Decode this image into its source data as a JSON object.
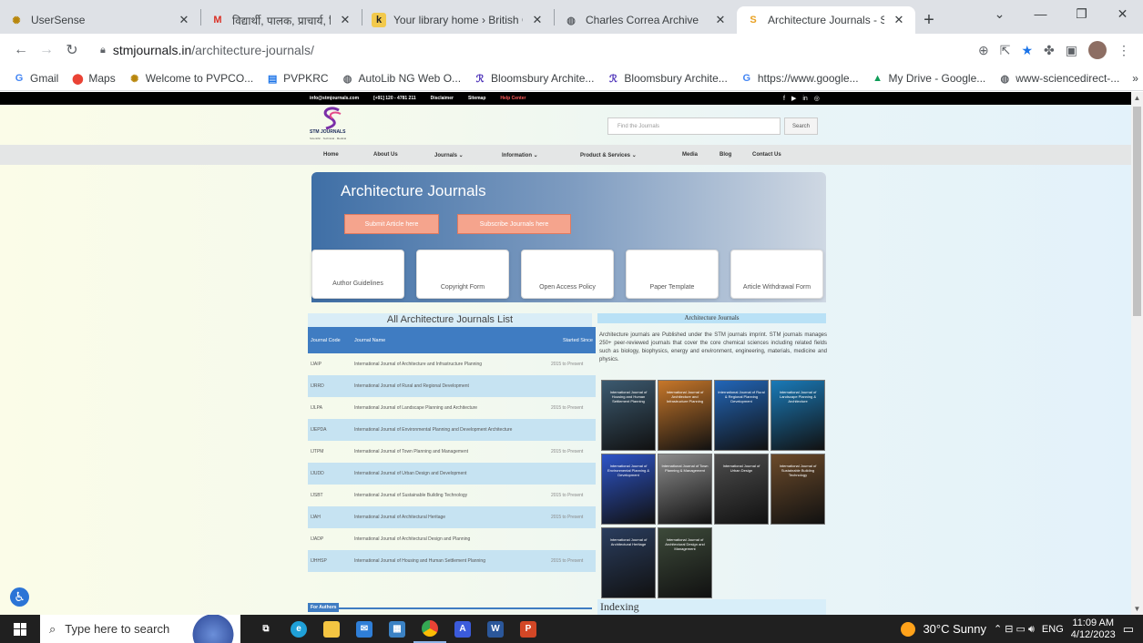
{
  "browser": {
    "tabs": [
      {
        "title": "UserSense",
        "icon": "usersense-icon"
      },
      {
        "title": "विद्यार्थी, पालक, प्राचार्य, शिक्षक,सं",
        "icon": "gmail-icon"
      },
      {
        "title": "Your library home › British Co",
        "icon": "library-icon"
      },
      {
        "title": "Charles Correa Archive",
        "icon": "globe-icon"
      },
      {
        "title": "Architecture Journals - STM J",
        "icon": "stm-icon"
      }
    ],
    "url_host": "stmjournals.in",
    "url_path": "/architecture-journals/",
    "bookmarks": [
      "Gmail",
      "Maps",
      "Welcome to PVPCO...",
      "PVPKRC",
      "AutoLib NG Web O...",
      "Bloomsbury Archite...",
      "Bloomsbury Archite...",
      "https://www.google...",
      "My Drive - Google...",
      "www-sciencedirect-..."
    ],
    "bookmarks_more": "»"
  },
  "site": {
    "topbar": {
      "email": "info@stmjournals.com",
      "phone": "[+91] 120 - 4781 211",
      "disclaimer": "Disclaimer",
      "sitemap": "Sitemap",
      "help": "Help Center"
    },
    "logo": {
      "text": "STM JOURNALS",
      "sub": "Scientific · Technical · Medical"
    },
    "search": {
      "placeholder": "Find the Journals",
      "button": "Search"
    },
    "nav": [
      "Home",
      "About Us",
      "Journals ⌄",
      "Information ⌄",
      "Product & Services ⌄",
      "Media",
      "Blog",
      "Contact Us"
    ],
    "hero": {
      "title": "Architecture Journals",
      "submit": "Submit Article here",
      "subscribe": "Subscribe Journals here"
    },
    "quick_links": [
      "Author Guidelines",
      "Copyright Form",
      "Open Access Policy",
      "Paper Template",
      "Article Withdrawal Form"
    ],
    "list_title": "All Architecture Journals List",
    "table_headers": {
      "code": "Journal Code",
      "name": "Journal Name",
      "since": "Started Since"
    },
    "journals": [
      {
        "code": "IJAIP",
        "name": "International Journal of Architecture and Infrastructure Planning",
        "since": "2015 to Present"
      },
      {
        "code": "IJRRD",
        "name": "International Journal of Rural and Regional Development",
        "since": ""
      },
      {
        "code": "IJLPA",
        "name": "International Journal of Landscape Planning and Architecture",
        "since": "2015 to Present"
      },
      {
        "code": "IJEPDA",
        "name": "International Journal of Environmental Planning and Development Architecture",
        "since": ""
      },
      {
        "code": "IJTPM",
        "name": "International Journal of Town Planning and Management",
        "since": "2015 to Present"
      },
      {
        "code": "IJUDD",
        "name": "International Journal of Urban Design and Development",
        "since": ""
      },
      {
        "code": "IJSBT",
        "name": "International Journal of Sustainable Building Technology",
        "since": "2015 to Present"
      },
      {
        "code": "IJAH",
        "name": "International Journal of Architectural Heritage",
        "since": "2015 to Present"
      },
      {
        "code": "IJADP",
        "name": "International Journal of Architectural Design and Planning",
        "since": ""
      },
      {
        "code": "IJHHSP",
        "name": "International Journal of Housing and Human Settlement Planning",
        "since": "2015 to Present"
      }
    ],
    "for_authors": "For Authors",
    "sidebar": {
      "heading": "Architecture Journals",
      "text": "Architecture journals are Published under the STM journals imprint. STM journals manages 250+ peer-reviewed journals that cover the core chemical sciences including related fields such as biology, biophysics, energy and environment, engineering, materials, medicine and physics.",
      "covers": [
        {
          "title": "International Journal of Housing and Human Settlement Planning",
          "color": "#3c5a70"
        },
        {
          "title": "International Journal of Architecture and Infrastructure Planning",
          "color": "#c7772a"
        },
        {
          "title": "International Journal of Rural & Regional Planning Development",
          "color": "#2266b8"
        },
        {
          "title": "International Journal of Landscape Planning & Architecture",
          "color": "#1a7ab8"
        },
        {
          "title": "International Journal of Environmental Planning & Development",
          "color": "#2d54c8"
        },
        {
          "title": "International Journal of Town Planning & Management",
          "color": "#8c8c8c"
        },
        {
          "title": "International Journal of Urban Design",
          "color": "#4d4d4d"
        },
        {
          "title": "International Journal of Sustainable Building Technology",
          "color": "#6b4a2a"
        },
        {
          "title": "International Journal of Architectural Heritage",
          "color": "#2a3d5e"
        },
        {
          "title": "International Journal of Architectural Design and Management",
          "color": "#3d4a3a"
        }
      ],
      "indexing": "Indexing"
    }
  },
  "taskbar": {
    "search_placeholder": "Type here to search",
    "weather": "30°C  Sunny",
    "lang": "ENG",
    "time": "11:09 AM",
    "date": "4/12/2023"
  }
}
